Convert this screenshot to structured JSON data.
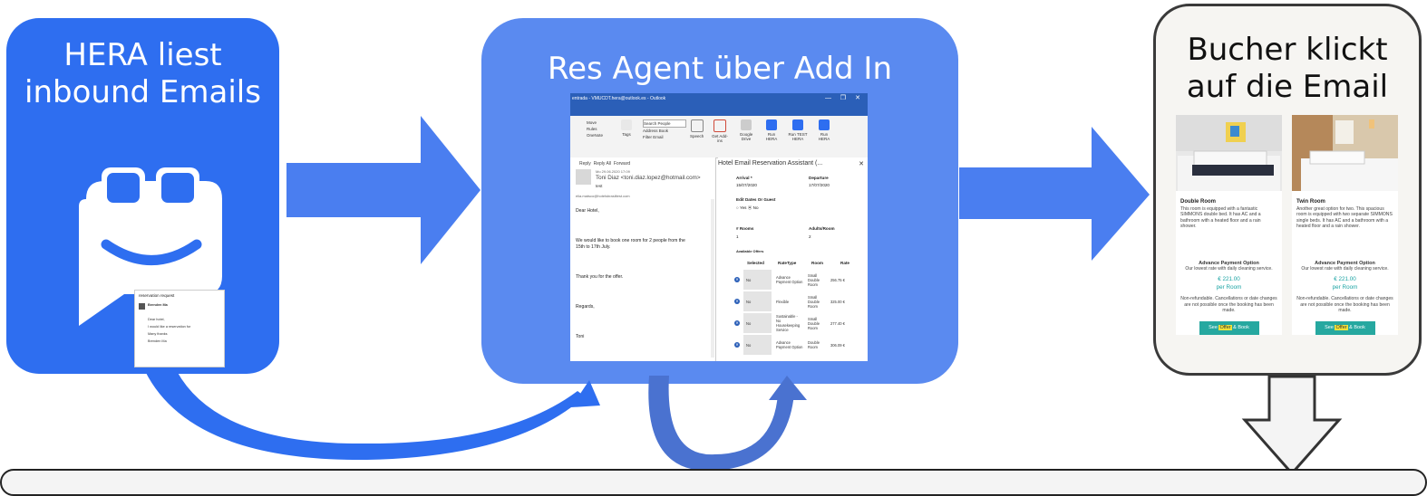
{
  "step1": {
    "title": "HERA liest inbound Emails"
  },
  "step2": {
    "title": "Res Agent über Add In"
  },
  "step3": {
    "title": "Bucher klickt auf die Email"
  },
  "email_snippet": {
    "subject": "reservation request",
    "sender": "Brenden Ma",
    "greeting": "Dear hotel,",
    "body": "I would like a reservation for",
    "signoff": "Many thanks",
    "name": "Brenden Ma"
  },
  "outlook": {
    "title": "entrada - VMUCDT.hera@outlook.es - Outlook",
    "ribbon": {
      "move": "Move",
      "rules": "Rules",
      "onenote": "OneNote",
      "move_group": "Move",
      "tags": "Tags",
      "search_people": "Search People",
      "address_book": "Address Book",
      "filter_email": "Filter Email",
      "find_group": "Find",
      "speech": "Speech",
      "get_addins": "Get Add-ins",
      "addins_group": "Add-ins",
      "google_drive": "Google Drive",
      "run_hera": "Run HERA",
      "run_test_hera": "Run TEST HERA",
      "run_hera2": "Run HERA",
      "hera_group": "HERA"
    },
    "reply": "Reply",
    "reply_all": "Reply All",
    "forward": "Forward",
    "date": "Mo 29.06.2020 17:09",
    "from": "Toni Diaz <toni.diaz.lopez@hotmail.com>",
    "subject": "test",
    "to": "elia.matsco@hotelsbrasiltest.com",
    "body": [
      "Dear Hotel,",
      "We would like to book one room for 2 people from the 15th to 17th July.",
      "Thank you for the offer.",
      "Regards,",
      "Toni"
    ]
  },
  "addin": {
    "title": "Hotel Email Reservation Assistant (...",
    "arrival_label": "Arrival *",
    "arrival_value": "15/07/2020",
    "departure_label": "Departure",
    "departure_value": "17/07/2020",
    "edit_label": "Edit Dates Or Guest",
    "yes": "Yes",
    "no": "No",
    "rooms_label": "# Rooms",
    "rooms_value": "1",
    "adults_label": "Adults/Room",
    "adults_value": "2",
    "offers_label": "Available Offers",
    "columns": [
      "Selected",
      "RateType",
      "Room",
      "Rate"
    ],
    "offers": [
      {
        "selected": "No",
        "ratetype": "Advance Payment Option",
        "room": "Small Double Room",
        "rate": "256.75 €"
      },
      {
        "selected": "No",
        "ratetype": "Flexible",
        "room": "Small Double Room",
        "rate": "325.00 €"
      },
      {
        "selected": "No",
        "ratetype": "Sustainable - No Housekeeping Service",
        "room": "Small Double Room",
        "rate": "277.40 €"
      },
      {
        "selected": "No",
        "ratetype": "Advance Payment Option",
        "room": "Double Room",
        "rate": "306.09 €"
      }
    ]
  },
  "rooms": [
    {
      "name": "Double Room",
      "desc": "This room is equipped with a fantastic SIMMONS double bed. It has AC and a bathroom with a heated floor and a rain shower.",
      "option": "Advance Payment Option",
      "option_desc": "Our lowest rate with daily cleaning service.",
      "price": "€ 221.00",
      "per": "per Room",
      "note": "Non-refundable. Cancellations or date changes are not possible once the booking has been made.",
      "button_pre": "See ",
      "button_mark": "Offer",
      "button_post": " & Book"
    },
    {
      "name": "Twin Room",
      "desc": "Another great option for two. This spacious room is equipped with two separate SIMMONS single beds. It has AC and a bathroom with a heated floor and a rain shower.",
      "option": "Advance Payment Option",
      "option_desc": "Our lowest rate with daily cleaning service.",
      "price": "€ 221.00",
      "per": "per Room",
      "note": "Non-refundable. Cancellations or date changes are not possible once the booking has been made.",
      "button_pre": "See ",
      "button_mark": "Offer",
      "button_post": " & Book"
    }
  ],
  "colors": {
    "step1": "#2e6ef0",
    "step2": "#5a8af0",
    "arrow": "#4a7ef0",
    "teal": "#26a8a0"
  }
}
